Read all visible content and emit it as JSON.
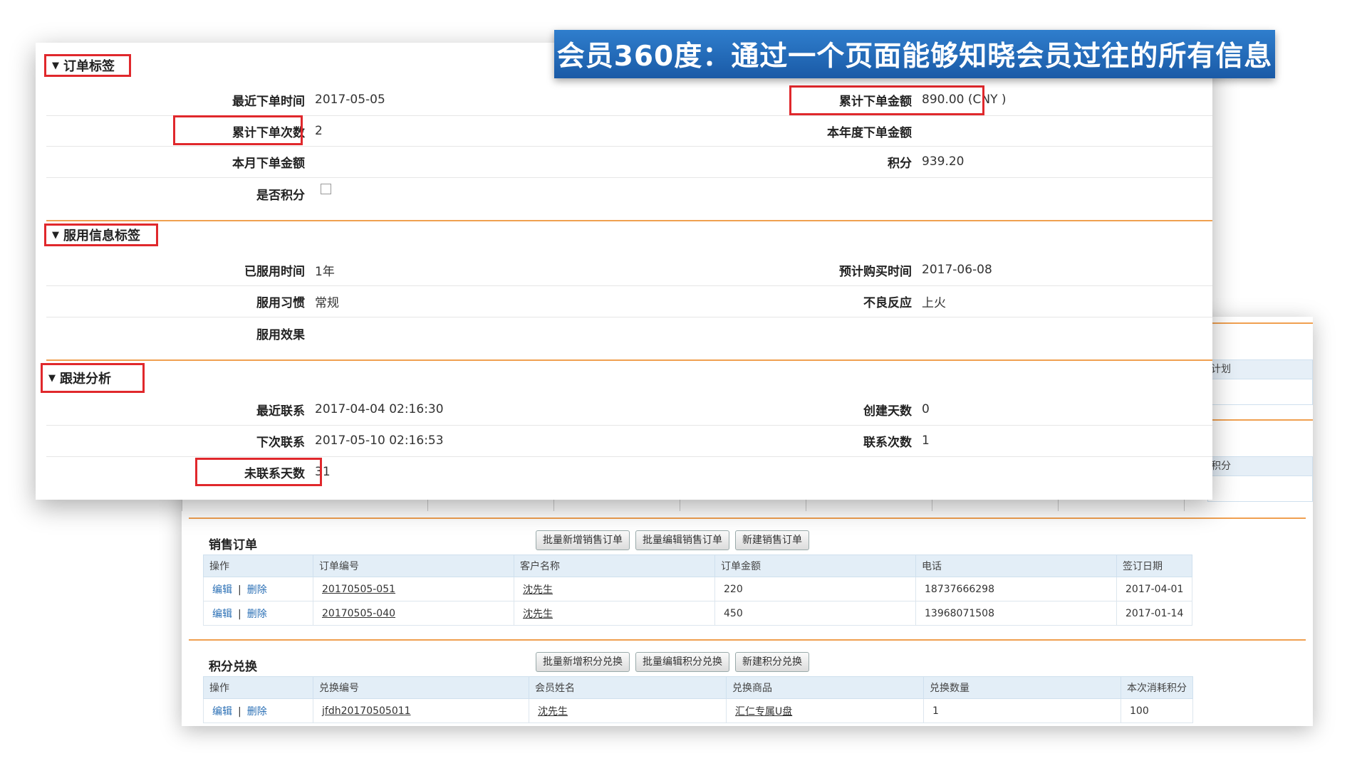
{
  "banner": {
    "title": "会员360度：通过一个页面能够知晓会员过往的所有信息"
  },
  "order_tag": {
    "title": "订单标签",
    "fields": {
      "last_order_time": {
        "label": "最近下单时间",
        "value": "2017-05-05"
      },
      "total_amount": {
        "label": "累计下单金额",
        "value": "890.00 (CNY )"
      },
      "total_count": {
        "label": "累计下单次数",
        "value": "2"
      },
      "year_amount": {
        "label": "本年度下单金额",
        "value": ""
      },
      "month_amount": {
        "label": "本月下单金额",
        "value": ""
      },
      "points": {
        "label": "积分",
        "value": "939.20"
      },
      "is_points": {
        "label": "是否积分",
        "value": ""
      }
    }
  },
  "usage_tag": {
    "title": "服用信息标签",
    "fields": {
      "used_time": {
        "label": "已服用时间",
        "value": "1年"
      },
      "expected_purchase": {
        "label": "预计购买时间",
        "value": "2017-06-08"
      },
      "habit": {
        "label": "服用习惯",
        "value": "常规"
      },
      "side_effect": {
        "label": "不良反应",
        "value": "上火"
      },
      "effect": {
        "label": "服用效果",
        "value": ""
      }
    }
  },
  "follow_tag": {
    "title": "跟进分析",
    "fields": {
      "last_contact": {
        "label": "最近联系",
        "value": "2017-04-04 02:16:30"
      },
      "created_days": {
        "label": "创建天数",
        "value": "0"
      },
      "next_contact": {
        "label": "下次联系",
        "value": "2017-05-10 02:16:53"
      },
      "contact_count": {
        "label": "联系次数",
        "value": "1"
      },
      "uncontacted_days": {
        "label": "未联系天数",
        "value": "31"
      }
    }
  },
  "peek": {
    "plan": "计划",
    "points": "积分"
  },
  "sales_orders": {
    "title": "销售订单",
    "buttons": [
      "批量新增销售订单",
      "批量编辑销售订单",
      "新建销售订单"
    ],
    "columns": [
      "操作",
      "订单编号",
      "客户名称",
      "订单金额",
      "电话",
      "签订日期"
    ],
    "rows": [
      {
        "edit": "编辑",
        "del": "删除",
        "order_no": "20170505-051",
        "customer": "沈先生",
        "amount": "220",
        "phone": "18737666298",
        "date": "2017-04-01"
      },
      {
        "edit": "编辑",
        "del": "删除",
        "order_no": "20170505-040",
        "customer": "沈先生",
        "amount": "450",
        "phone": "13968071508",
        "date": "2017-01-14"
      }
    ]
  },
  "points_exchange": {
    "title": "积分兑换",
    "buttons": [
      "批量新增积分兑换",
      "批量编辑积分兑换",
      "新建积分兑换"
    ],
    "columns": [
      "操作",
      "兑换编号",
      "会员姓名",
      "兑换商品",
      "兑换数量",
      "本次消耗积分"
    ],
    "rows": [
      {
        "edit": "编辑",
        "del": "删除",
        "ex_no": "jfdh20170505011",
        "member": "沈先生",
        "product": "汇仁专属U盘",
        "qty": "1",
        "cost": "100"
      }
    ]
  }
}
